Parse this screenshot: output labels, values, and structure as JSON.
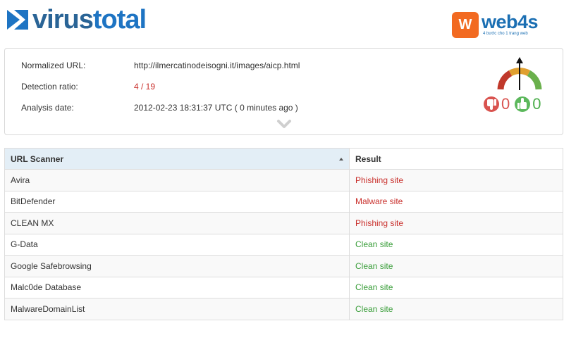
{
  "header": {
    "logo_part1": "virus",
    "logo_part2": "total",
    "partner_badge": "W",
    "partner_name": "web4s",
    "partner_tagline": "4 bước cho 1 trang web"
  },
  "info": {
    "url_label": "Normalized URL:",
    "url_value": "http://ilmercatinodeisogni.it/images/aicp.html",
    "ratio_label": "Detection ratio:",
    "ratio_value": "4 / 19",
    "date_label": "Analysis date:",
    "date_value": "2012-02-23 18:31:37 UTC ( 0 minutes ago )"
  },
  "votes": {
    "bad": "0",
    "good": "0"
  },
  "table": {
    "col_scanner": "URL Scanner",
    "col_result": "Result",
    "rows": [
      {
        "scanner": "Avira",
        "result": "Phishing site",
        "status": "bad"
      },
      {
        "scanner": "BitDefender",
        "result": "Malware site",
        "status": "bad"
      },
      {
        "scanner": "CLEAN MX",
        "result": "Phishing site",
        "status": "bad"
      },
      {
        "scanner": "G-Data",
        "result": "Clean site",
        "status": "good"
      },
      {
        "scanner": "Google Safebrowsing",
        "result": "Clean site",
        "status": "good"
      },
      {
        "scanner": "Malc0de Database",
        "result": "Clean site",
        "status": "good"
      },
      {
        "scanner": "MalwareDomainList",
        "result": "Clean site",
        "status": "good"
      }
    ]
  },
  "colors": {
    "detected": "#c9302c",
    "clean": "#3a9e3a",
    "header_highlight": "#e3eef6"
  }
}
